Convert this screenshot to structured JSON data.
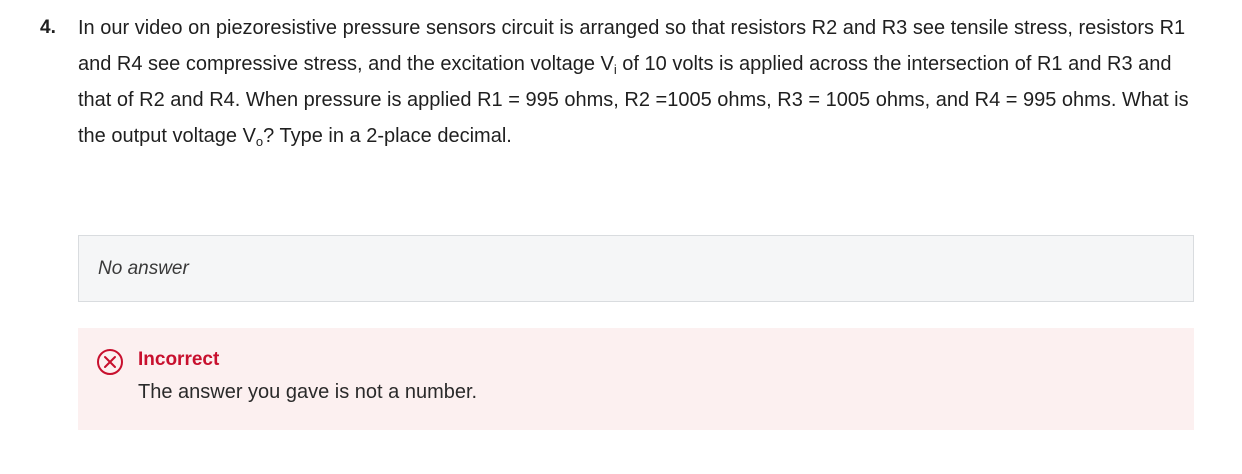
{
  "question": {
    "number": "4.",
    "text_part1": "In our video on piezoresistive pressure sensors circuit is arranged so that resistors R2 and R3 see tensile stress, resistors R1 and R4 see compressive stress, and the excitation voltage V",
    "sub_i": "i",
    "text_part2": " of 10 volts is applied across the intersection of R1 and R3 and that of R2 and R4. When pressure is applied R1 = 995 ohms, R2 =1005 ohms, R3 = 1005 ohms, and R4 = 995 ohms. What is the output voltage V",
    "sub_o": "o",
    "text_part3": "? Type in a 2-place decimal."
  },
  "answer": {
    "value": "No answer"
  },
  "feedback": {
    "status": "Incorrect",
    "message": "The answer you gave is not a number.",
    "icon": "x-circle-icon",
    "status_color": "#c8102e",
    "background_color": "#fcf0f0"
  }
}
